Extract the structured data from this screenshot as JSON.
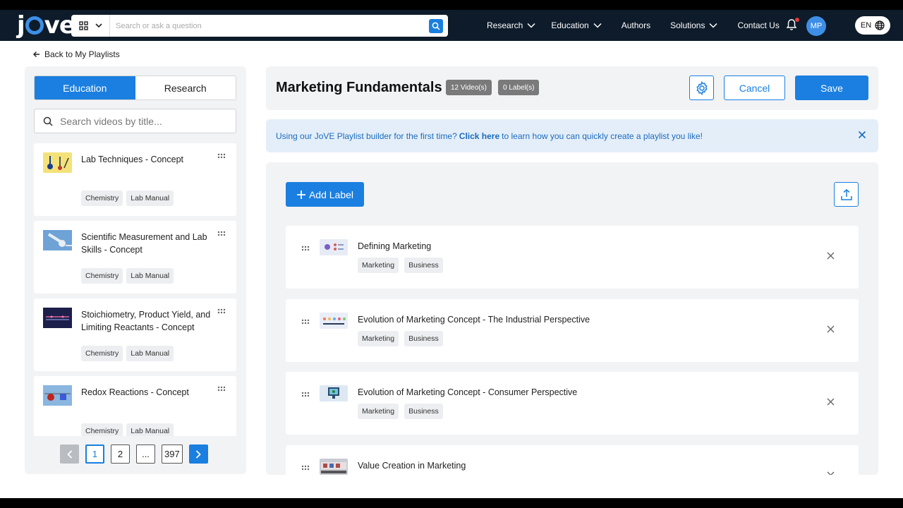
{
  "header": {
    "logo_text": "jove",
    "search_placeholder": "Search or ask a question",
    "nav": [
      "Research",
      "Education",
      "Authors",
      "Solutions",
      "Contact Us"
    ],
    "avatar_initials": "MP",
    "language": "EN"
  },
  "back_link": "Back to My Playlists",
  "library": {
    "tabs": [
      "Education",
      "Research"
    ],
    "active_tab": "Education",
    "search_placeholder": "Search videos by title...",
    "videos": [
      {
        "title": "Lab Techniques - Concept",
        "tags": [
          "Chemistry",
          "Lab Manual"
        ]
      },
      {
        "title": "Scientific Measurement and Lab Skills - Concept",
        "tags": [
          "Chemistry",
          "Lab Manual"
        ]
      },
      {
        "title": "Stoichiometry, Product Yield, and Limiting Reactants - Concept",
        "tags": [
          "Chemistry",
          "Lab Manual"
        ]
      },
      {
        "title": "Redox Reactions - Concept",
        "tags": [
          "Chemistry",
          "Lab Manual"
        ]
      }
    ],
    "pagination": {
      "pages": [
        "1",
        "2",
        "...",
        "397"
      ],
      "current": "1"
    }
  },
  "playlist": {
    "title": "Marketing Fundamentals",
    "video_count": "12 Video(s)",
    "label_count": "0 Label(s)",
    "cancel_label": "Cancel",
    "save_label": "Save",
    "info_pre": "Using our JoVE Playlist builder for the first time?",
    "info_link": "Click here",
    "info_post": "to learn how you can quickly create a playlist you like!",
    "add_label": "Add Label",
    "items": [
      {
        "title": "Defining Marketing",
        "tags": [
          "Marketing",
          "Business"
        ]
      },
      {
        "title": "Evolution of Marketing Concept - The Industrial Perspective",
        "tags": [
          "Marketing",
          "Business"
        ]
      },
      {
        "title": "Evolution of Marketing Concept - Consumer Perspective",
        "tags": [
          "Marketing",
          "Business"
        ]
      },
      {
        "title": "Value Creation in Marketing",
        "tags": []
      }
    ]
  },
  "colors": {
    "accent": "#1a7fe0",
    "header_bg": "#0d1b2a",
    "info_bg": "#e4eef9"
  }
}
